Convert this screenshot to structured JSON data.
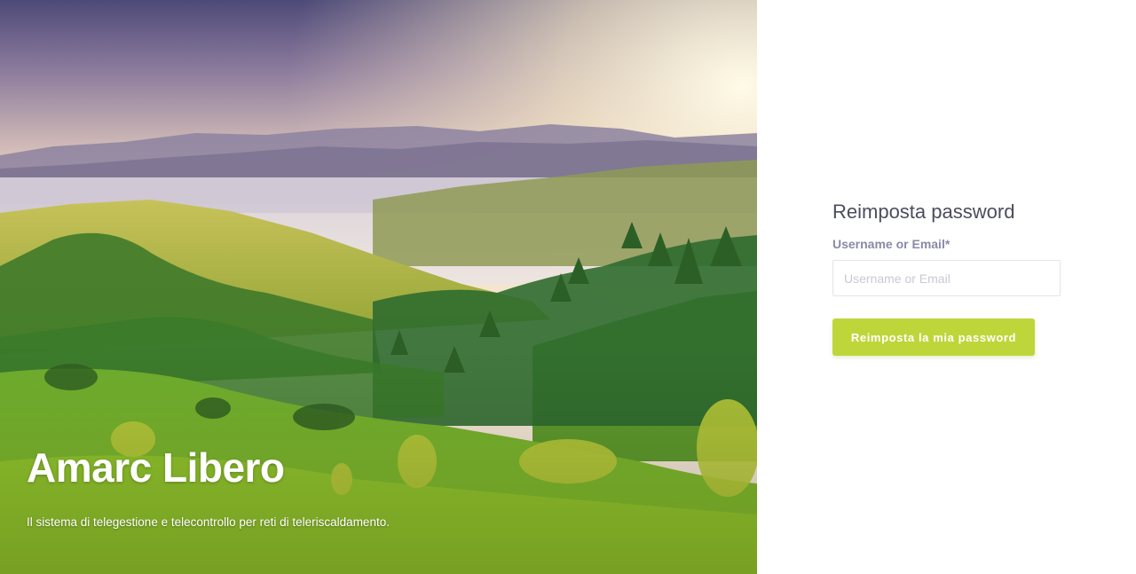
{
  "hero": {
    "title": "Amarc Libero",
    "subtitle": "Il sistema di telegestione e telecontrollo per reti di teleriscaldamento."
  },
  "form": {
    "title": "Reimposta password",
    "username_label": "Username or Email*",
    "username_placeholder": "Username or Email",
    "username_value": "",
    "submit_label": "Reimposta la mia password"
  },
  "colors": {
    "accent": "#bfd63a",
    "title_text": "#4b4c5e",
    "label_text": "#8a89a6"
  },
  "icons": {
    "hero_image": "landscape-photo"
  }
}
